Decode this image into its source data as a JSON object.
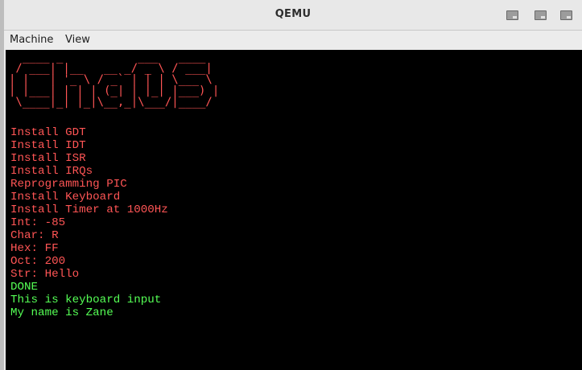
{
  "window": {
    "title": "QEMU"
  },
  "titlebar_buttons": [
    {
      "name": "minimize-button"
    },
    {
      "name": "maximize-button"
    },
    {
      "name": "close-button"
    }
  ],
  "menubar": {
    "items": [
      "Machine",
      "View"
    ]
  },
  "logo": {
    "lines": [
      "  ____ _           ___   ____",
      " / ___| |__   __ _/ _ \\ / ___|",
      "| |   | '_ \\ / _` | | | \\___ \\",
      "| |___| | | | (_| | |_| |___) |",
      " \\____|_| |_|\\__,_|\\___/|____/"
    ],
    "color": "#ff5555"
  },
  "console": {
    "lines": [
      {
        "text": "Install GDT",
        "color": "red"
      },
      {
        "text": "Install IDT",
        "color": "red"
      },
      {
        "text": "Install ISR",
        "color": "red"
      },
      {
        "text": "Install IRQs",
        "color": "red"
      },
      {
        "text": "Reprogramming PIC",
        "color": "red"
      },
      {
        "text": "Install Keyboard",
        "color": "red"
      },
      {
        "text": "Install Timer at 1000Hz",
        "color": "red"
      },
      {
        "text": "Int: -85",
        "color": "red"
      },
      {
        "text": "Char: R",
        "color": "red"
      },
      {
        "text": "Hex: FF",
        "color": "red"
      },
      {
        "text": "Oct: 200",
        "color": "red"
      },
      {
        "text": "Str: Hello",
        "color": "red"
      },
      {
        "text": "DONE",
        "color": "green"
      },
      {
        "text": "This is keyboard input",
        "color": "green"
      },
      {
        "text": "My name is Zane",
        "color": "green"
      }
    ]
  },
  "colors": {
    "red": "#ff5555",
    "green": "#55ff55",
    "screen_bg": "#000000"
  }
}
